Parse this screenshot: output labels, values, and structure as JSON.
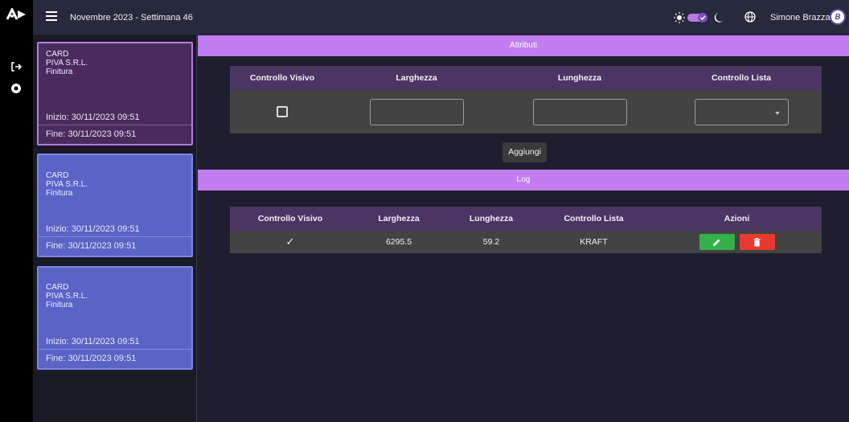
{
  "header": {
    "title": "Novembre 2023 - Settimana 46",
    "user_name": "Simone Brazzarola",
    "avatar_letter": "B"
  },
  "cards": [
    {
      "type": "CARD",
      "company": "PIVA S.R.L.",
      "stage": "Finitura",
      "start": "Inizio: 30/11/2023 09:51",
      "end": "Fine: 30/11/2023 09:51",
      "active": true
    },
    {
      "type": "CARD",
      "company": "PIVA S.R.L.",
      "stage": "Finitura",
      "start": "Inizio: 30/11/2023 09:51",
      "end": "Fine: 30/11/2023 09:51",
      "active": false
    },
    {
      "type": "CARD",
      "company": "PIVA S.R.L.",
      "stage": "Finitura",
      "start": "Inizio: 30/11/2023 09:51",
      "end": "Fine: 30/11/2023 09:51",
      "active": false
    }
  ],
  "attributes": {
    "title": "Attributi",
    "columns": [
      "Controllo Visivo",
      "Larghezza",
      "Lunghezza",
      "Controllo Lista"
    ],
    "add_label": "Aggiungi"
  },
  "log": {
    "title": "Log",
    "columns": [
      "Controllo Visivo",
      "Larghezza",
      "Lunghezza",
      "Controllo Lista",
      "Azioni"
    ],
    "rows": [
      {
        "check": "✓",
        "larghezza": "6295.5",
        "lunghezza": "59.2",
        "lista": "KRAFT"
      }
    ]
  },
  "colors": {
    "accent": "#c17df0",
    "card_active": "#4b2b5e",
    "card_normal": "#5a63c6",
    "edit": "#34b04a",
    "delete": "#e8392f"
  }
}
